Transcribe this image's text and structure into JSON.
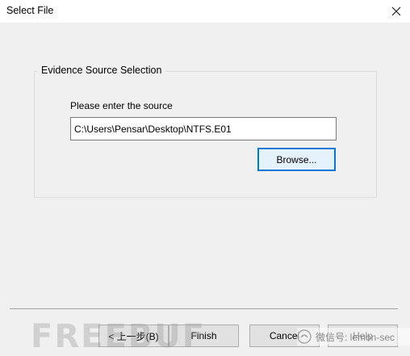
{
  "window": {
    "title": "Select File"
  },
  "evidence_group": {
    "legend": "Evidence Source Selection",
    "prompt": "Please enter the source",
    "source_value": "C:\\Users\\Pensar\\Desktop\\NTFS.E01",
    "browse_label": "Browse..."
  },
  "footer": {
    "back_label": "< 上一步(B)",
    "finish_label": "Finish",
    "cancel_label": "Cancel",
    "help_label": "Help"
  },
  "watermarks": {
    "left_text": "FREEBUF",
    "right_text": "微信号: lemon-sec"
  },
  "colors": {
    "focus_border": "#0078d7",
    "dialog_bg": "#f0f0f0"
  }
}
